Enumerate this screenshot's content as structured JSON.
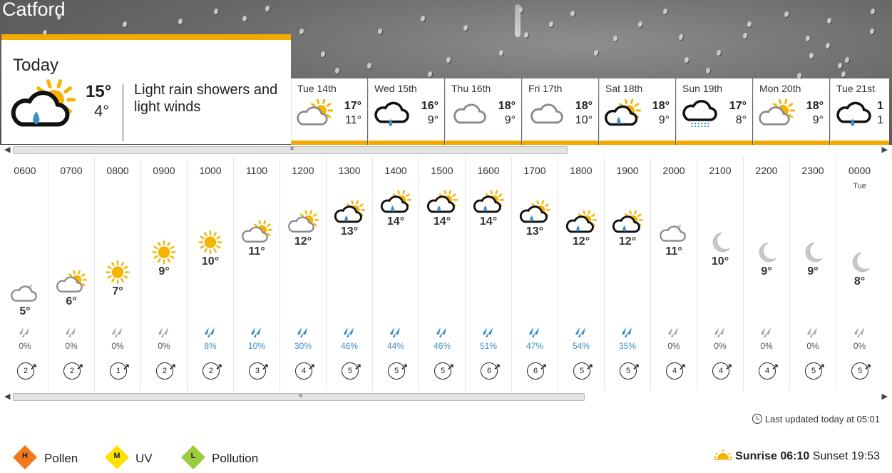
{
  "location": "Catford",
  "today": {
    "label": "Today",
    "max": "15°",
    "min": "4°",
    "description": "Light rain showers and light winds",
    "icon": "sun-cloud-rain-icon"
  },
  "days": [
    {
      "name": "Tue",
      "date": "14th",
      "max": "17°",
      "min": "11°",
      "icon": "sun-cloud-icon"
    },
    {
      "name": "Wed",
      "date": "15th",
      "max": "16°",
      "min": "9°",
      "icon": "cloud-rain-icon"
    },
    {
      "name": "Thu",
      "date": "16th",
      "max": "18°",
      "min": "9°",
      "icon": "cloud-icon"
    },
    {
      "name": "Fri",
      "date": "17th",
      "max": "18°",
      "min": "10°",
      "icon": "cloud-icon"
    },
    {
      "name": "Sat",
      "date": "18th",
      "max": "18°",
      "min": "9°",
      "icon": "sun-cloud-rain-icon"
    },
    {
      "name": "Sun",
      "date": "19th",
      "max": "17°",
      "min": "8°",
      "icon": "cloud-drizzle-icon"
    },
    {
      "name": "Mon",
      "date": "20th",
      "max": "18°",
      "min": "9°",
      "icon": "sun-cloud-icon"
    },
    {
      "name": "Tue",
      "date": "21st",
      "max": "1",
      "min": "1",
      "icon": "cloud-rain-icon"
    }
  ],
  "hours": [
    {
      "time": "0600",
      "day": "",
      "temp": "5°",
      "icon": "moon-cloud-icon",
      "rain": "0%",
      "wind": "2"
    },
    {
      "time": "0700",
      "day": "",
      "temp": "6°",
      "icon": "sun-cloud-icon",
      "rain": "0%",
      "wind": "2"
    },
    {
      "time": "0800",
      "day": "",
      "temp": "7°",
      "icon": "sun-icon",
      "rain": "0%",
      "wind": "1"
    },
    {
      "time": "0900",
      "day": "",
      "temp": "9°",
      "icon": "sun-icon",
      "rain": "0%",
      "wind": "2"
    },
    {
      "time": "1000",
      "day": "",
      "temp": "10°",
      "icon": "sun-icon",
      "rain": "8%",
      "wind": "2"
    },
    {
      "time": "1100",
      "day": "",
      "temp": "11°",
      "icon": "sun-cloud-icon",
      "rain": "10%",
      "wind": "3"
    },
    {
      "time": "1200",
      "day": "",
      "temp": "12°",
      "icon": "sun-cloud-icon",
      "rain": "30%",
      "wind": "4"
    },
    {
      "time": "1300",
      "day": "",
      "temp": "13°",
      "icon": "sun-cloud-rain-icon",
      "rain": "46%",
      "wind": "5"
    },
    {
      "time": "1400",
      "day": "",
      "temp": "14°",
      "icon": "sun-cloud-rain-icon",
      "rain": "44%",
      "wind": "5"
    },
    {
      "time": "1500",
      "day": "",
      "temp": "14°",
      "icon": "sun-cloud-rain-icon",
      "rain": "46%",
      "wind": "5"
    },
    {
      "time": "1600",
      "day": "",
      "temp": "14°",
      "icon": "sun-cloud-rain-icon",
      "rain": "51%",
      "wind": "6"
    },
    {
      "time": "1700",
      "day": "",
      "temp": "13°",
      "icon": "sun-cloud-rain-icon",
      "rain": "47%",
      "wind": "6"
    },
    {
      "time": "1800",
      "day": "",
      "temp": "12°",
      "icon": "sun-cloud-rain-icon",
      "rain": "54%",
      "wind": "5"
    },
    {
      "time": "1900",
      "day": "",
      "temp": "12°",
      "icon": "sun-cloud-rain-icon",
      "rain": "35%",
      "wind": "5"
    },
    {
      "time": "2000",
      "day": "",
      "temp": "11°",
      "icon": "moon-cloud-icon",
      "rain": "0%",
      "wind": "4"
    },
    {
      "time": "2100",
      "day": "",
      "temp": "10°",
      "icon": "moon-icon",
      "rain": "0%",
      "wind": "4"
    },
    {
      "time": "2200",
      "day": "",
      "temp": "9°",
      "icon": "moon-icon",
      "rain": "0%",
      "wind": "4"
    },
    {
      "time": "2300",
      "day": "",
      "temp": "9°",
      "icon": "moon-icon",
      "rain": "0%",
      "wind": "5"
    },
    {
      "time": "0000",
      "day": "Tue",
      "temp": "8°",
      "icon": "moon-icon",
      "rain": "0%",
      "wind": "5"
    }
  ],
  "updated": "Last updated today at 05:01",
  "indices": [
    {
      "letter": "H",
      "label": "Pollen",
      "color": "#f07a1b"
    },
    {
      "letter": "M",
      "label": "UV",
      "color": "#ffe100"
    },
    {
      "letter": "L",
      "label": "Pollution",
      "color": "#9bcc3f"
    }
  ],
  "sunrise_label": "Sunrise",
  "sunrise": "06:10",
  "sunset_label": "Sunset",
  "sunset": "19:53",
  "colors": {
    "accent": "#f5a800",
    "rain_blue": "#3d8fc9"
  }
}
